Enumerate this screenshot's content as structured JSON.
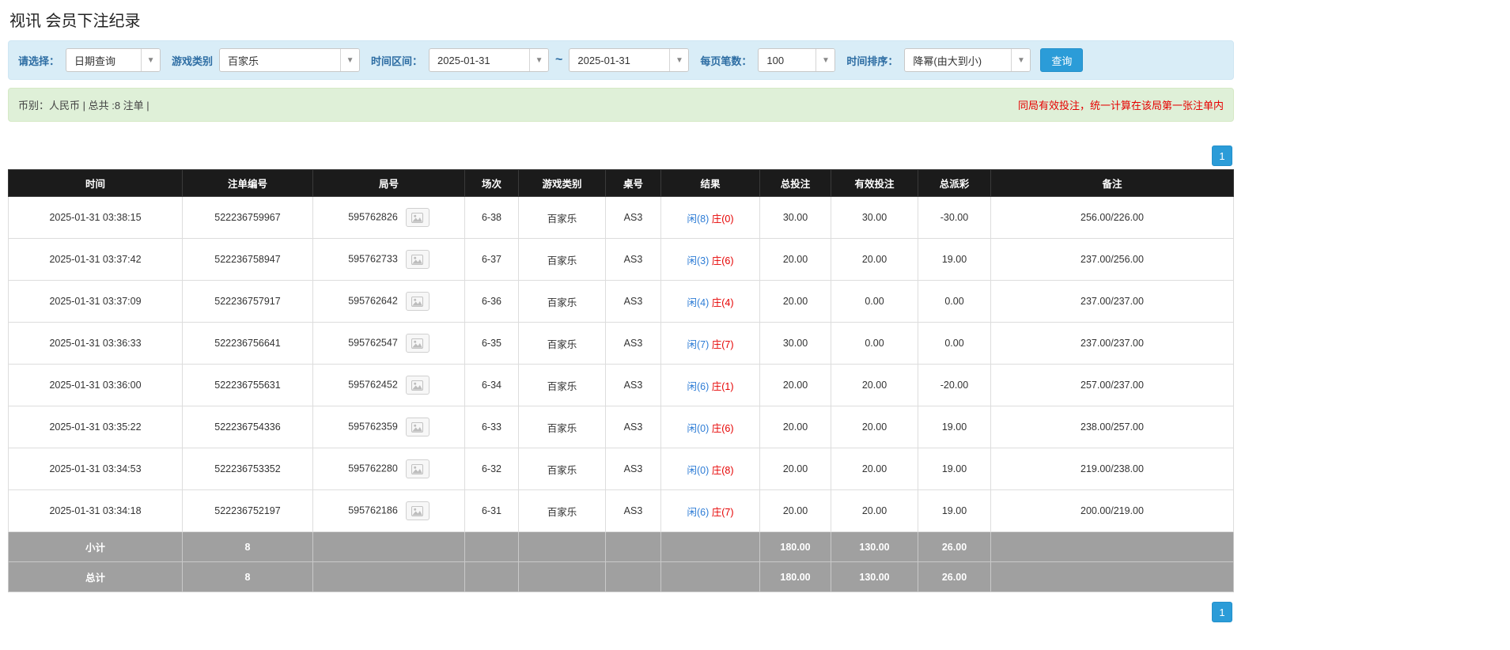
{
  "page": {
    "title": "视讯 会员下注纪录"
  },
  "filters": {
    "query_type_label": "请选择：",
    "query_type_value": "日期查询",
    "game_type_label": "游戏类别",
    "game_type_value": "百家乐",
    "time_range_label": "时间区间：",
    "date_from": "2025-01-31",
    "tilde": "~",
    "date_to": "2025-01-31",
    "page_size_label": "每页笔数：",
    "page_size_value": "100",
    "sort_label": "时间排序：",
    "sort_value": "降幂(由大到小)",
    "search_button": "查询"
  },
  "summary": {
    "left": "币别：人民币 | 总共 :8 注单 |",
    "right": "同局有效投注，统一计算在该局第一张注单内"
  },
  "pagination": {
    "page": "1"
  },
  "table": {
    "headers": [
      "时间",
      "注单编号",
      "局号",
      "场次",
      "游戏类别",
      "桌号",
      "结果",
      "总投注",
      "有效投注",
      "总派彩",
      "备注"
    ],
    "rows": [
      {
        "time": "2025-01-31 03:38:15",
        "bet_id": "522236759967",
        "round_id": "595762826",
        "session": "6-38",
        "game": "百家乐",
        "table_no": "AS3",
        "result_player": "闲(8)",
        "result_banker": "庄(0)",
        "total_bet": "30.00",
        "valid_bet": "30.00",
        "payout": "-30.00",
        "remark": "256.00/226.00"
      },
      {
        "time": "2025-01-31 03:37:42",
        "bet_id": "522236758947",
        "round_id": "595762733",
        "session": "6-37",
        "game": "百家乐",
        "table_no": "AS3",
        "result_player": "闲(3)",
        "result_banker": "庄(6)",
        "total_bet": "20.00",
        "valid_bet": "20.00",
        "payout": "19.00",
        "remark": "237.00/256.00"
      },
      {
        "time": "2025-01-31 03:37:09",
        "bet_id": "522236757917",
        "round_id": "595762642",
        "session": "6-36",
        "game": "百家乐",
        "table_no": "AS3",
        "result_player": "闲(4)",
        "result_banker": "庄(4)",
        "total_bet": "20.00",
        "valid_bet": "0.00",
        "payout": "0.00",
        "remark": "237.00/237.00"
      },
      {
        "time": "2025-01-31 03:36:33",
        "bet_id": "522236756641",
        "round_id": "595762547",
        "session": "6-35",
        "game": "百家乐",
        "table_no": "AS3",
        "result_player": "闲(7)",
        "result_banker": "庄(7)",
        "total_bet": "30.00",
        "valid_bet": "0.00",
        "payout": "0.00",
        "remark": "237.00/237.00"
      },
      {
        "time": "2025-01-31 03:36:00",
        "bet_id": "522236755631",
        "round_id": "595762452",
        "session": "6-34",
        "game": "百家乐",
        "table_no": "AS3",
        "result_player": "闲(6)",
        "result_banker": "庄(1)",
        "total_bet": "20.00",
        "valid_bet": "20.00",
        "payout": "-20.00",
        "remark": "257.00/237.00"
      },
      {
        "time": "2025-01-31 03:35:22",
        "bet_id": "522236754336",
        "round_id": "595762359",
        "session": "6-33",
        "game": "百家乐",
        "table_no": "AS3",
        "result_player": "闲(0)",
        "result_banker": "庄(6)",
        "total_bet": "20.00",
        "valid_bet": "20.00",
        "payout": "19.00",
        "remark": "238.00/257.00"
      },
      {
        "time": "2025-01-31 03:34:53",
        "bet_id": "522236753352",
        "round_id": "595762280",
        "session": "6-32",
        "game": "百家乐",
        "table_no": "AS3",
        "result_player": "闲(0)",
        "result_banker": "庄(8)",
        "total_bet": "20.00",
        "valid_bet": "20.00",
        "payout": "19.00",
        "remark": "219.00/238.00"
      },
      {
        "time": "2025-01-31 03:34:18",
        "bet_id": "522236752197",
        "round_id": "595762186",
        "session": "6-31",
        "game": "百家乐",
        "table_no": "AS3",
        "result_player": "闲(6)",
        "result_banker": "庄(7)",
        "total_bet": "20.00",
        "valid_bet": "20.00",
        "payout": "19.00",
        "remark": "200.00/219.00"
      }
    ],
    "subtotal": {
      "label": "小计",
      "count": "8",
      "total_bet": "180.00",
      "valid_bet": "130.00",
      "payout": "26.00"
    },
    "total": {
      "label": "总计",
      "count": "8",
      "total_bet": "180.00",
      "valid_bet": "130.00",
      "payout": "26.00"
    }
  }
}
